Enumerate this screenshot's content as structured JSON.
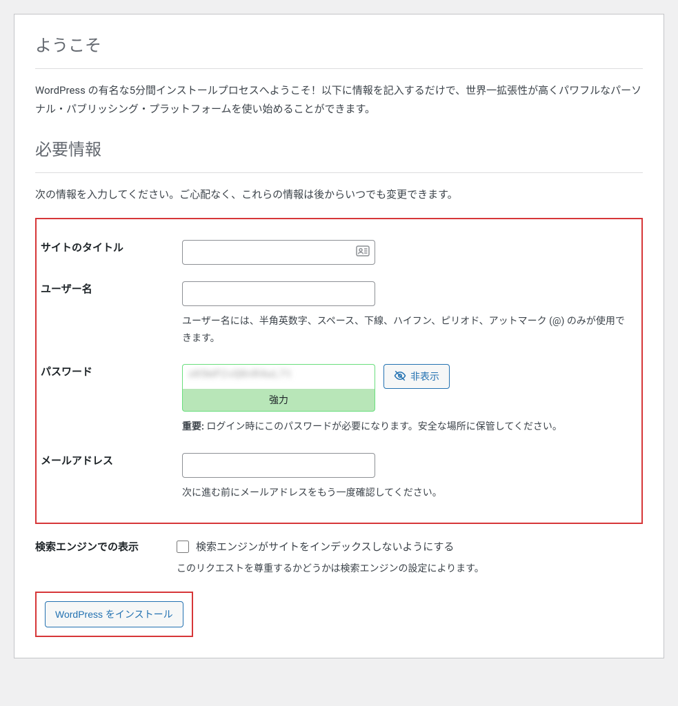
{
  "welcome": {
    "heading": "ようこそ",
    "intro": "WordPress の有名な5分間インストールプロセスへようこそ！以下に情報を記入するだけで、世界一拡張性が高くパワフルなパーソナル・パブリッシング・プラットフォームを使い始めることができます。"
  },
  "info": {
    "heading": "必要情報",
    "intro": "次の情報を入力してください。ご心配なく、これらの情報は後からいつでも変更できます。"
  },
  "fields": {
    "site_title": {
      "label": "サイトのタイトル",
      "value": ""
    },
    "username": {
      "label": "ユーザー名",
      "value": "",
      "desc": "ユーザー名には、半角英数字、スペース、下線、ハイフン、ピリオド、アットマーク (@) のみが使用できます。"
    },
    "password": {
      "label": "パスワード",
      "hide_button": "非表示",
      "strength": "強力",
      "important_label": "重要:",
      "important_text": " ログイン時にこのパスワードが必要になります。安全な場所に保管してください。"
    },
    "email": {
      "label": "メールアドレス",
      "value": "",
      "desc": "次に進む前にメールアドレスをもう一度確認してください。"
    },
    "search_engine": {
      "label": "検索エンジンでの表示",
      "checkbox_label": "検索エンジンがサイトをインデックスしないようにする",
      "desc": "このリクエストを尊重するかどうかは検索エンジンの設定によります。"
    }
  },
  "submit": {
    "label": "WordPress をインストール"
  }
}
